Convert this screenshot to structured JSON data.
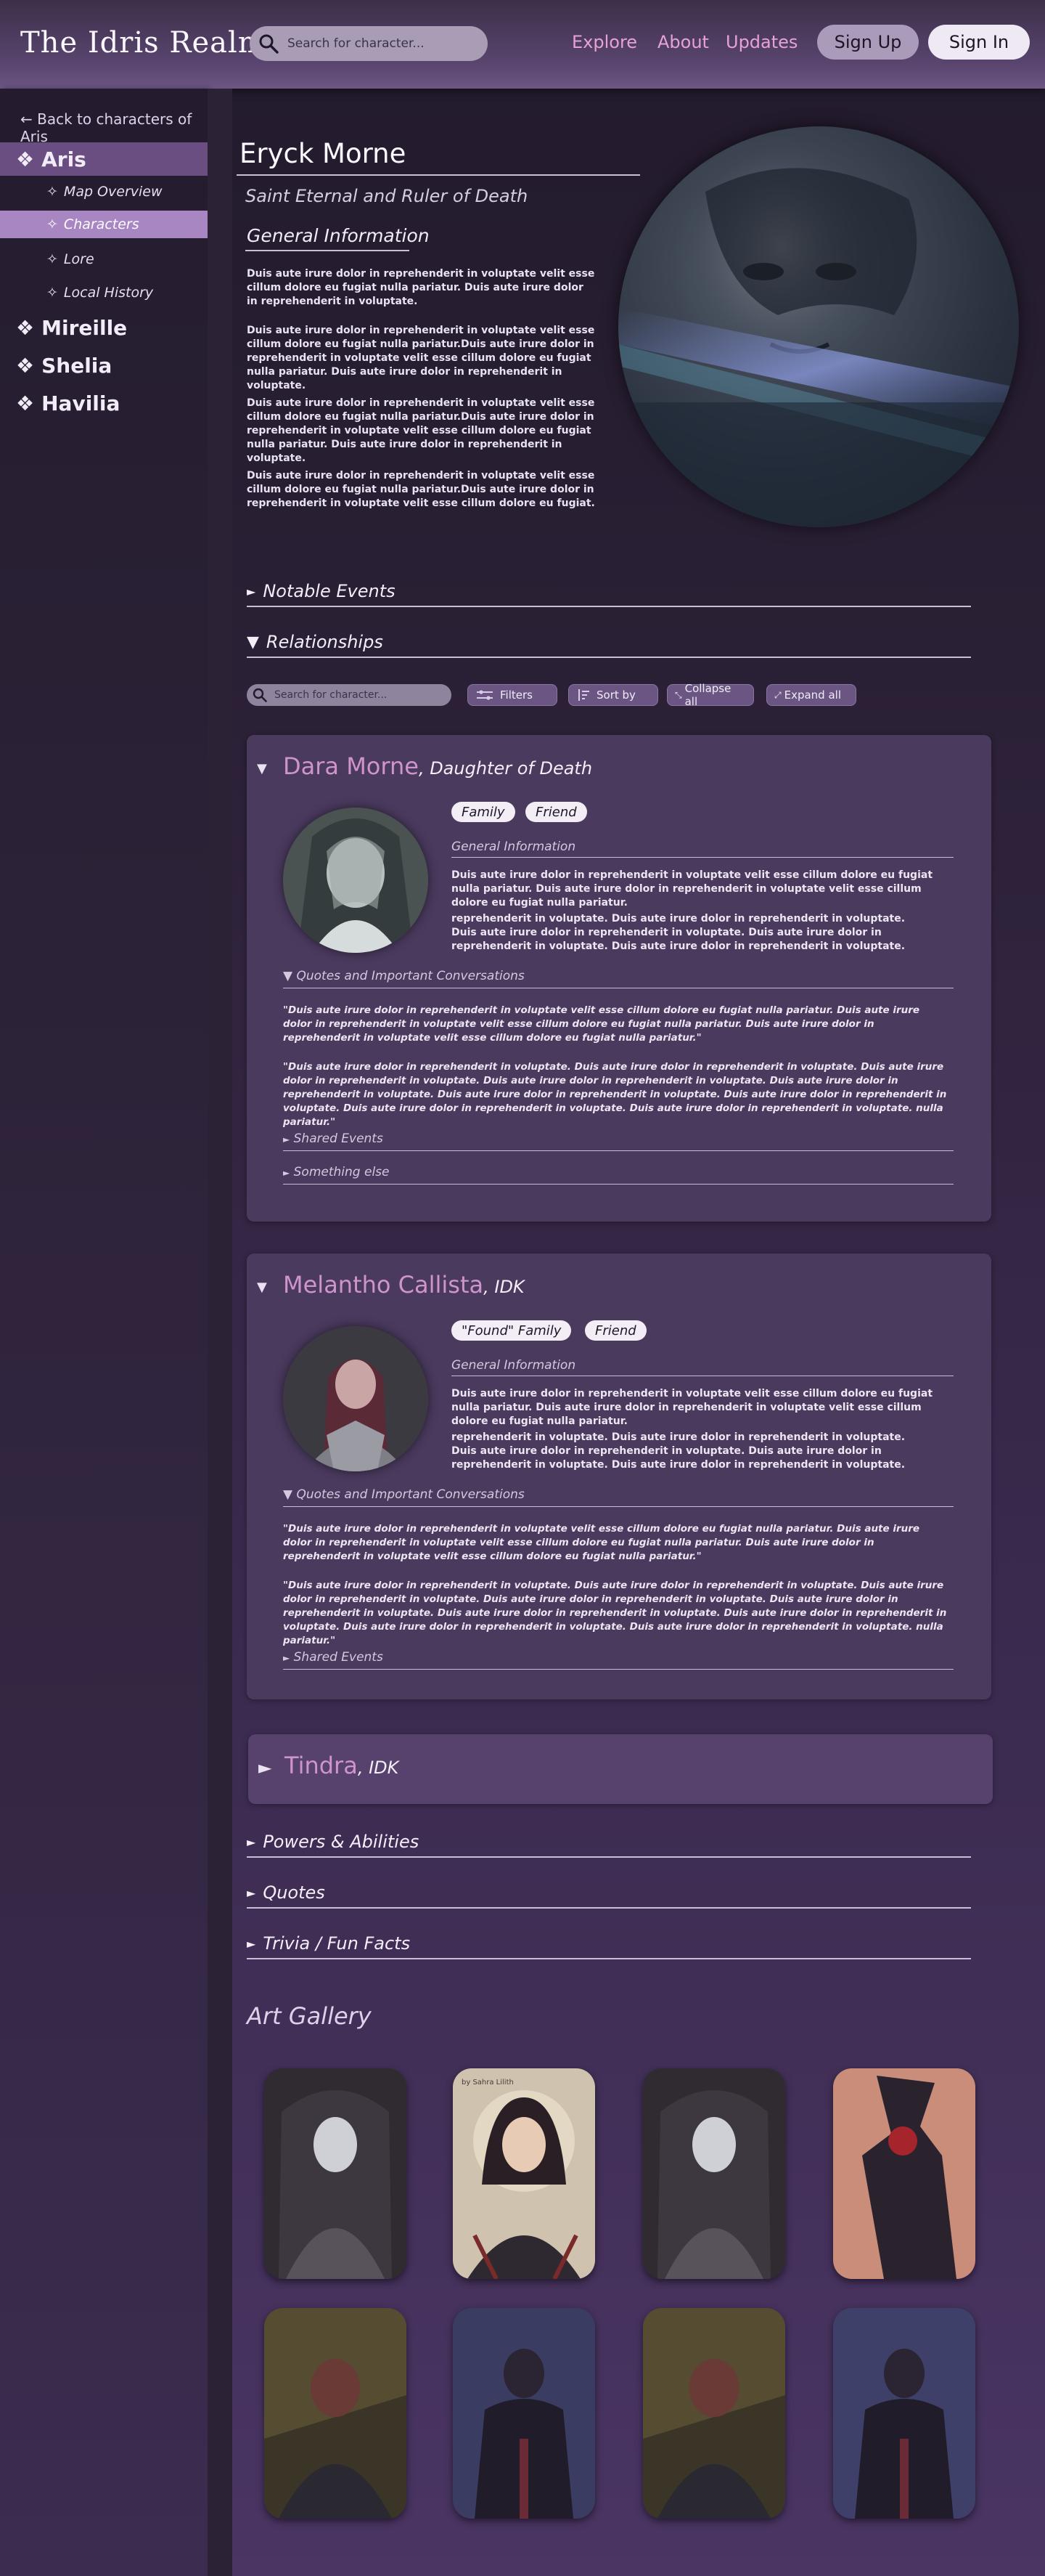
{
  "header": {
    "brand": "The Idris Realm",
    "search_placeholder": "Search for character...",
    "nav": [
      "Explore",
      "About",
      "Updates"
    ],
    "signup": "Sign Up",
    "signin": "Sign In"
  },
  "sidebar": {
    "back": "← Back to characters of Aris",
    "realms": [
      "Aris",
      "Mireille",
      "Shelia",
      "Havilia"
    ],
    "sub_items": [
      "Map Overview",
      "Characters",
      "Lore",
      "Local History"
    ]
  },
  "character": {
    "name": "Eryck Morne",
    "subtitle": "Saint Eternal and Ruler of Death",
    "general_heading": "General Information",
    "paragraphs": [
      "Duis aute irure dolor in reprehenderit in voluptate velit esse cillum dolore eu fugiat nulla pariatur. Duis aute irure dolor in reprehenderit in voluptate.",
      "Duis aute irure dolor in reprehenderit in voluptate velit esse cillum dolore eu fugiat nulla pariatur.Duis aute irure dolor in reprehenderit in voluptate velit esse cillum dolore eu fugiat nulla pariatur. Duis aute irure dolor in reprehenderit in voluptate.",
      "Duis aute irure dolor in reprehenderit in voluptate velit esse cillum dolore eu fugiat nulla pariatur.Duis aute irure dolor in reprehenderit in voluptate velit esse cillum dolore eu fugiat nulla pariatur. Duis aute irure dolor in reprehenderit in voluptate.",
      "Duis aute irure dolor in reprehenderit in voluptate velit esse cillum dolore eu fugiat nulla pariatur.Duis aute irure dolor in reprehenderit in voluptate velit esse cillum dolore eu fugiat."
    ]
  },
  "sections": {
    "notable_events": "Notable Events",
    "relationships": "Relationships",
    "powers": "Powers & Abilities",
    "quotes": "Quotes",
    "trivia": "Trivia / Fun Facts"
  },
  "toolbar": {
    "search_placeholder": "Search for character...",
    "filters": "Filters",
    "sort": "Sort by",
    "collapse": "Collapse all",
    "expand": "Expand all"
  },
  "relationships": [
    {
      "name": "Dara Morne",
      "role": "Daughter of Death",
      "tags": [
        "Family",
        "Friend"
      ],
      "general": "General Information",
      "p1": "Duis aute irure dolor in reprehenderit in voluptate velit esse cillum dolore eu fugiat nulla pariatur. Duis aute irure dolor in reprehenderit in voluptate velit esse cillum dolore eu fugiat nulla pariatur.",
      "p2": "reprehenderit in voluptate. Duis aute irure dolor in reprehenderit in voluptate. Duis aute irure dolor in reprehenderit in voluptate. Duis aute irure dolor in reprehenderit in voluptate. Duis aute irure dolor in reprehenderit in voluptate.",
      "quotes_h": "Quotes and Important Conversations",
      "q1": "\"Duis aute irure dolor in reprehenderit in voluptate velit esse cillum dolore eu fugiat nulla pariatur. Duis aute irure dolor in reprehenderit in voluptate velit esse cillum dolore eu fugiat nulla pariatur. Duis aute irure dolor in reprehenderit in voluptate velit esse cillum dolore eu fugiat nulla pariatur.\"",
      "q2": "\"Duis aute irure dolor in reprehenderit in voluptate. Duis aute irure dolor in reprehenderit in voluptate. Duis aute irure dolor in reprehenderit in voluptate.  Duis aute irure dolor in reprehenderit in voluptate. Duis aute irure dolor in reprehenderit in voluptate. Duis aute irure dolor in reprehenderit in voluptate. Duis aute irure dolor in reprehenderit in voluptate. Duis aute irure dolor in reprehenderit in voluptate. Duis aute irure dolor in reprehenderit in voluptate. nulla pariatur.\"",
      "shared": "Shared Events",
      "extra": "Something else"
    },
    {
      "name": "Melantho Callista",
      "role": "IDK",
      "tags": [
        "\"Found\" Family",
        "Friend"
      ],
      "general": "General Information",
      "p1": "Duis aute irure dolor in reprehenderit in voluptate velit esse cillum dolore eu fugiat nulla pariatur. Duis aute irure dolor in reprehenderit in voluptate velit esse cillum dolore eu fugiat nulla pariatur.",
      "p2": "reprehenderit in voluptate. Duis aute irure dolor in reprehenderit in voluptate. Duis aute irure dolor in reprehenderit in voluptate. Duis aute irure dolor in reprehenderit in voluptate. Duis aute irure dolor in reprehenderit in voluptate.",
      "quotes_h": "Quotes and Important Conversations",
      "q1": "\"Duis aute irure dolor in reprehenderit in voluptate velit esse cillum dolore eu fugiat nulla pariatur. Duis aute irure dolor in reprehenderit in voluptate velit esse cillum dolore eu fugiat nulla pariatur. Duis aute irure dolor in reprehenderit in voluptate velit esse cillum dolore eu fugiat nulla pariatur.\"",
      "q2": "\"Duis aute irure dolor in reprehenderit in voluptate. Duis aute irure dolor in reprehenderit in voluptate. Duis aute irure dolor in reprehenderit in voluptate.  Duis aute irure dolor in reprehenderit in voluptate. Duis aute irure dolor in reprehenderit in voluptate. Duis aute irure dolor in reprehenderit in voluptate. Duis aute irure dolor in reprehenderit in voluptate. Duis aute irure dolor in reprehenderit in voluptate. Duis aute irure dolor in reprehenderit in voluptate. nulla pariatur.\"",
      "shared": "Shared Events"
    },
    {
      "name": "Tindra",
      "role": "IDK"
    }
  ],
  "gallery": {
    "title": "Art Gallery",
    "thumb_caption": "by Sahra Lilith"
  },
  "colors": {
    "accent_pink": "#cf94cb",
    "nav_pink": "#e6a2d6",
    "card_bg": "#4a3a5e",
    "sidebar_active": "#6a4e82",
    "sidebar_sub_active": "#a886c2"
  }
}
